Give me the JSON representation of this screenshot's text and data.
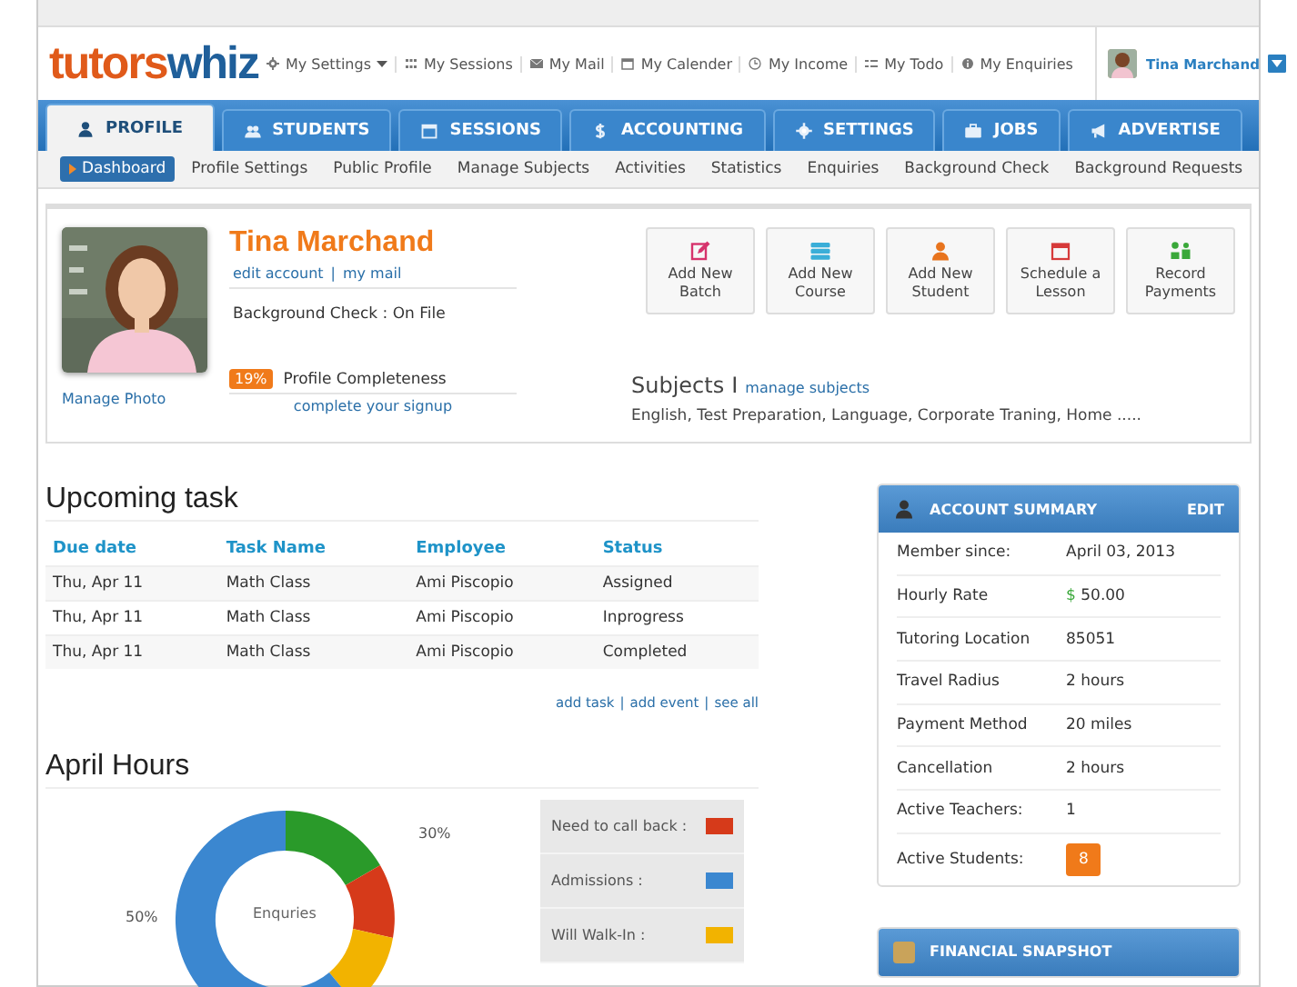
{
  "logo": {
    "part1": "tutors",
    "part2": "whiz"
  },
  "top_links": [
    {
      "label": "My Settings",
      "caret": true
    },
    {
      "label": "My Sessions",
      "caret": false
    },
    {
      "label": "My Mail",
      "caret": false
    },
    {
      "label": "My Calender",
      "caret": false
    },
    {
      "label": "My Income",
      "caret": false
    },
    {
      "label": "My Todo",
      "caret": false
    },
    {
      "label": "My Enquiries",
      "caret": false
    }
  ],
  "user": {
    "name": "Tina Marchand"
  },
  "tabs": [
    {
      "label": "PROFILE",
      "selected": true
    },
    {
      "label": "STUDENTS",
      "selected": false
    },
    {
      "label": "SESSIONS",
      "selected": false
    },
    {
      "label": "ACCOUNTING",
      "selected": false
    },
    {
      "label": "SETTINGS",
      "selected": false
    },
    {
      "label": "JOBS",
      "selected": false
    },
    {
      "label": "ADVERTISE",
      "selected": false
    }
  ],
  "subnav": [
    {
      "label": "Dashboard",
      "selected": true
    },
    {
      "label": "Profile Settings",
      "selected": false
    },
    {
      "label": "Public Profile",
      "selected": false
    },
    {
      "label": "Manage Subjects",
      "selected": false
    },
    {
      "label": "Activities",
      "selected": false
    },
    {
      "label": "Statistics",
      "selected": false
    },
    {
      "label": "Enquiries",
      "selected": false
    },
    {
      "label": "Background Check",
      "selected": false
    },
    {
      "label": "Background Requests",
      "selected": false
    }
  ],
  "profile": {
    "name": "Tina Marchand",
    "links": [
      "edit account",
      "my mail"
    ],
    "links_separator": "|",
    "background_check": "Background Check : On File",
    "completeness_badge": "19%",
    "completeness_label": "Profile Completeness",
    "signup_link": "complete your signup",
    "manage_photo": "Manage Photo"
  },
  "actions": [
    {
      "label": "Add New Batch"
    },
    {
      "label": "Add New Course"
    },
    {
      "label": "Add New Student"
    },
    {
      "label": "Schedule a Lesson"
    },
    {
      "label": "Record Payments"
    }
  ],
  "subjects": {
    "title": "Subjects",
    "separator": "I",
    "link": "manage subjects",
    "list": "English, Test Preparation, Language, Corporate Traning, Home ....."
  },
  "upcoming": {
    "title": "Upcoming task",
    "columns": [
      "Due date",
      "Task Name",
      "Employee",
      "Status"
    ],
    "rows": [
      [
        "Thu, Apr 11",
        "Math Class",
        "Ami Piscopio",
        "Assigned"
      ],
      [
        "Thu, Apr 11",
        "Math Class",
        "Ami Piscopio",
        "Inprogress"
      ],
      [
        "Thu, Apr 11",
        "Math Class",
        "Ami Piscopio",
        "Completed"
      ]
    ],
    "links": [
      "add task",
      "add event",
      "see all"
    ],
    "links_separator": "|"
  },
  "april_hours": {
    "title": "April Hours",
    "center_label": "Enquries",
    "slice_labels": [
      "30%",
      "50%"
    ],
    "legend": [
      {
        "label": "Need to call back :",
        "color": "#d63a1a"
      },
      {
        "label": "Admissions :",
        "color": "#3b87d0"
      },
      {
        "label": "Will Walk-In :",
        "color": "#f2b300"
      }
    ]
  },
  "account_summary": {
    "title": "ACCOUNT SUMMARY",
    "edit": "EDIT",
    "rows": [
      {
        "label": "Member since:",
        "value": "April 03, 2013",
        "kind": "text"
      },
      {
        "label": "Hourly Rate",
        "value": "$ 50.00",
        "kind": "money"
      },
      {
        "label": "Tutoring Location",
        "value": "85051",
        "kind": "text"
      },
      {
        "label": "Travel Radius",
        "value": "2 hours",
        "kind": "text"
      },
      {
        "label": "Payment Method",
        "value": "20 miles",
        "kind": "text"
      },
      {
        "label": "Cancellation",
        "value": "2 hours",
        "kind": "text"
      },
      {
        "label": "Active Teachers:",
        "value": "1",
        "kind": "text"
      },
      {
        "label": "Active Students:",
        "value": "8",
        "kind": "badge"
      }
    ]
  },
  "financial_snapshot": {
    "title": "FINANCIAL SNAPSHOT"
  }
}
